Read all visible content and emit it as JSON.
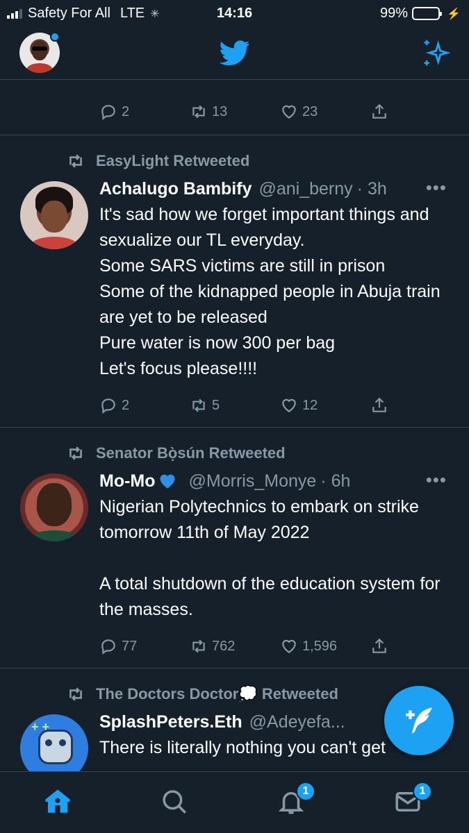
{
  "status_bar": {
    "carrier": "Safety For All",
    "network": "LTE",
    "time": "14:16",
    "battery": "99%",
    "battery_level": 0.99
  },
  "header": {
    "logo_icon": "twitter-bird-icon",
    "sparkle_icon": "sparkle-icon"
  },
  "top_tweet_actions": {
    "replies": "2",
    "retweets": "13",
    "likes": "23"
  },
  "tweets": [
    {
      "retweeted_by": "EasyLight Retweeted",
      "name": "Achalugo Bambify",
      "handle": "@ani_berny",
      "time": "· 3h",
      "text": "It's sad how we forget important things and sexualize our TL everyday.\nSome SARS victims are still in prison\nSome of the kidnapped people in Abuja train are yet to be released\nPure water is now 300 per bag\nLet's focus please!!!!",
      "replies": "2",
      "retweets": "5",
      "likes": "12"
    },
    {
      "retweeted_by": "Senator Bọ̀sún Retweeted",
      "name": "Mo-Mo",
      "handle": "@Morris_Monye",
      "time": "· 6h",
      "text": "Nigerian Polytechnics to embark on strike tomorrow 11th of May 2022\n\nA total shutdown of the education system for the masses.",
      "replies": "77",
      "retweets": "762",
      "likes": "1,596"
    },
    {
      "retweeted_by": "The Doctors Doctor💭 Retweeted",
      "name": "SplashPeters.Eth",
      "handle": "@Adeyefa...",
      "time": "",
      "text": "There is literally nothing you can't get"
    }
  ],
  "tab_bar": {
    "notifications_badge": "1",
    "messages_badge": "1"
  },
  "more_label": "•••"
}
